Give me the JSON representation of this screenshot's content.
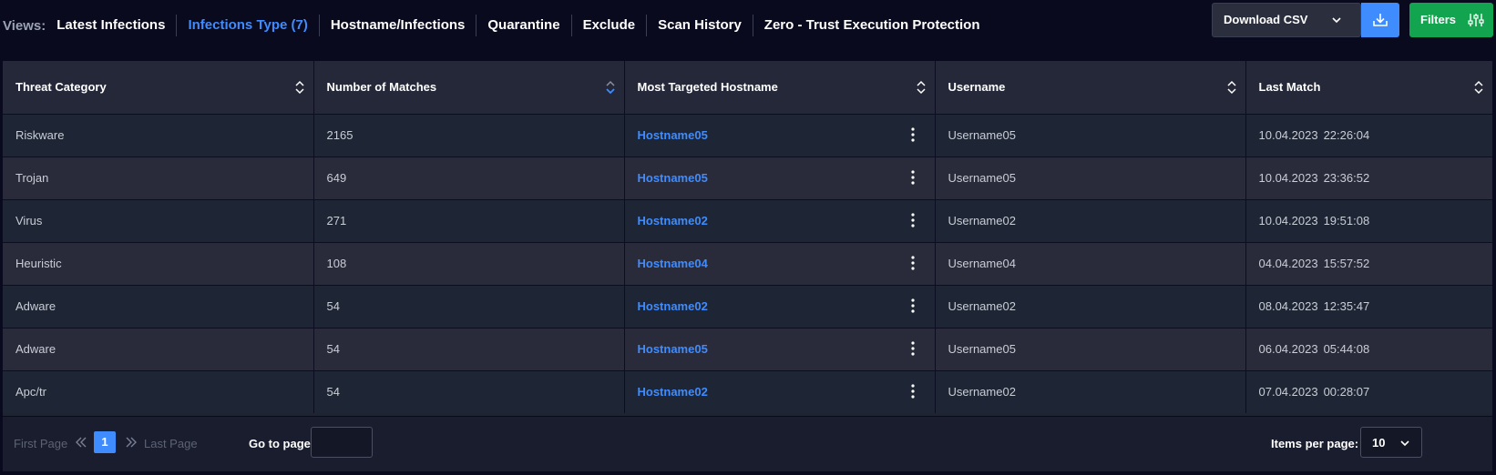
{
  "views": {
    "label": "Views:",
    "tabs": [
      {
        "label": "Latest Infections",
        "active": false
      },
      {
        "label": "Infections Type (7)",
        "active": true
      },
      {
        "label": "Hostname/Infections",
        "active": false
      },
      {
        "label": "Quarantine",
        "active": false
      },
      {
        "label": "Exclude",
        "active": false
      },
      {
        "label": "Scan History",
        "active": false
      },
      {
        "label": "Zero - Trust Execution Protection",
        "active": false
      }
    ]
  },
  "toolbar": {
    "download_csv_label": "Download CSV",
    "filters_label": "Filters"
  },
  "table": {
    "columns": [
      "Threat Category",
      "Number of Matches",
      "Most Targeted Hostname",
      "Username",
      "Last Match"
    ],
    "rows": [
      {
        "category": "Riskware",
        "matches": "2165",
        "hostname": "Hostname05",
        "username": "Username05",
        "date": "10.04.2023",
        "time": "22:26:04"
      },
      {
        "category": "Trojan",
        "matches": "649",
        "hostname": "Hostname05",
        "username": "Username05",
        "date": "10.04.2023",
        "time": "23:36:52"
      },
      {
        "category": "Virus",
        "matches": "271",
        "hostname": "Hostname02",
        "username": "Username02",
        "date": "10.04.2023",
        "time": "19:51:08"
      },
      {
        "category": "Heuristic",
        "matches": "108",
        "hostname": "Hostname04",
        "username": "Username04",
        "date": "04.04.2023",
        "time": "15:57:52"
      },
      {
        "category": "Adware",
        "matches": "54",
        "hostname": "Hostname02",
        "username": "Username02",
        "date": "08.04.2023",
        "time": "12:35:47"
      },
      {
        "category": "Adware",
        "matches": "54",
        "hostname": "Hostname05",
        "username": "Username05",
        "date": "06.04.2023",
        "time": "05:44:08"
      },
      {
        "category": "Apc/tr",
        "matches": "54",
        "hostname": "Hostname02",
        "username": "Username02",
        "date": "07.04.2023",
        "time": "00:28:07"
      }
    ]
  },
  "pagination": {
    "first_label": "First Page",
    "last_label": "Last Page",
    "current_page": "1",
    "goto_label": "Go to page:",
    "goto_value": "",
    "items_per_page_label": "Items per page:",
    "items_per_page_value": "10"
  },
  "colors": {
    "accent": "#3f8cff",
    "filters_green": "#13a44f",
    "background": "#090a1e"
  },
  "icons": {
    "sort": "sort-updown-icon",
    "kebab": "kebab-menu-icon",
    "download": "download-icon",
    "filters": "sliders-icon",
    "chevron": "chevron-down-icon"
  }
}
